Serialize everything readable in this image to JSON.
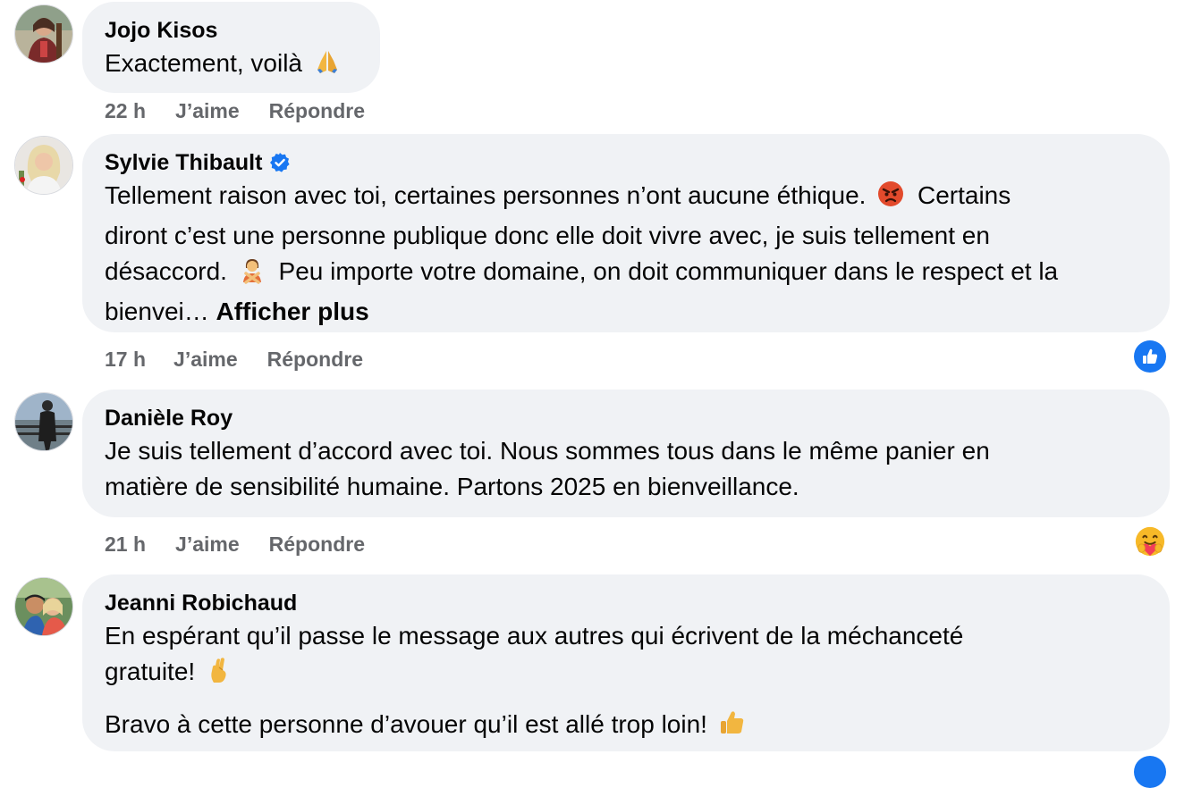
{
  "comments": [
    {
      "author": "Jojo Kisos",
      "verified": false,
      "paragraphs": [
        "Exactement, voilà"
      ],
      "emoji_icons": [
        "folded-hands-icon"
      ],
      "time": "22 h",
      "like_label": "J’aime",
      "reply_label": "Répondre"
    },
    {
      "author": "Sylvie Thibault",
      "verified": true,
      "lines": [
        "Tellement raison avec toi, certaines personnes n’ont aucune éthique.",
        "Certains",
        "diront c’est une personne publique donc elle doit vivre avec, je suis tellement en",
        "désaccord.",
        "Peu importe votre domaine, on doit communiquer dans le respect et la",
        "bienvei…"
      ],
      "see_more": "Afficher plus",
      "time": "17 h",
      "like_label": "J’aime",
      "reply_label": "Répondre",
      "reaction": "like-reaction-icon",
      "emoji_icons": [
        "angry-face-icon",
        "person-gesturing-no-icon"
      ]
    },
    {
      "author": "Danièle Roy",
      "verified": false,
      "lines": [
        "Je suis tellement d’accord avec toi. Nous sommes tous dans le même panier en",
        "matière de sensibilité humaine. Partons 2025 en bienveillance."
      ],
      "time": "21 h",
      "like_label": "J’aime",
      "reply_label": "Répondre",
      "reaction": "care-reaction-icon"
    },
    {
      "author": "Jeanni Robichaud",
      "verified": false,
      "lines": [
        "En espérant qu’il passe le message aux autres qui écrivent de la méchanceté",
        "gratuite!",
        "Bravo à cette personne d’avouer qu’il est allé trop loin!"
      ],
      "emoji_icons": [
        "crossed-fingers-icon",
        "thumbs-up-icon"
      ]
    }
  ],
  "colors": {
    "bubble": "#f0f2f5",
    "meta_text": "#65676b",
    "like_blue": "#1877f2",
    "verified_blue": "#1877f2"
  }
}
